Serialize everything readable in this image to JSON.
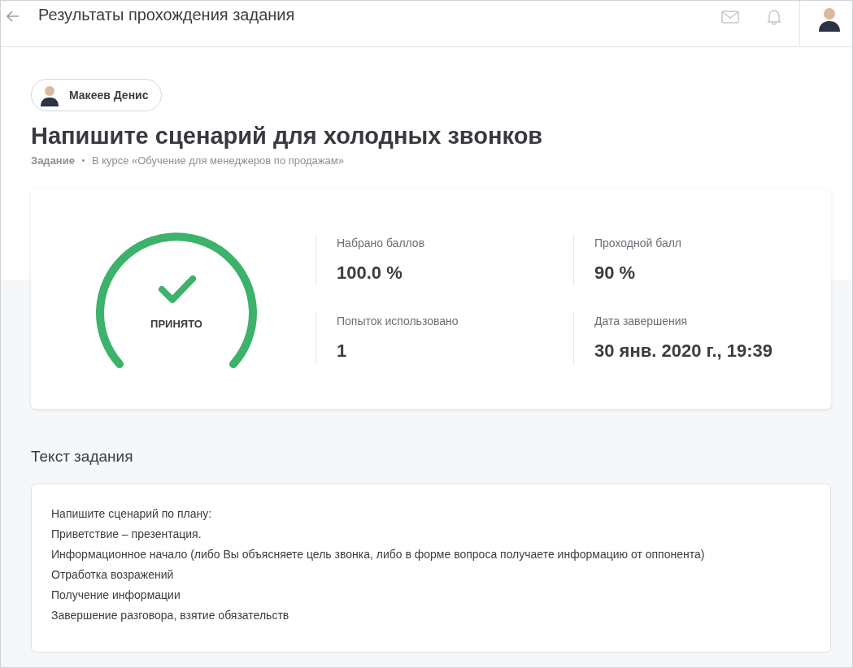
{
  "header": {
    "title": "Результаты прохождения задания"
  },
  "student": {
    "name": "Макеев Денис"
  },
  "task": {
    "title": "Напишите сценарий для холодных звонков",
    "type": "Задание",
    "course": "В курсе «Обучение для менеджеров по продажам»"
  },
  "result": {
    "accepted": true,
    "status_label": "ПРИНЯТО",
    "stats": [
      {
        "label": "Набрано баллов",
        "value": "100.0 %"
      },
      {
        "label": "Проходной балл",
        "value": "90 %"
      },
      {
        "label": "Попыток использовано",
        "value": "1"
      },
      {
        "label": "Дата завершения",
        "value": "30 янв. 2020 г., 19:39"
      }
    ]
  },
  "task_text": {
    "heading": "Текст задания",
    "lines": [
      "Напишите сценарий по плану:",
      "Приветствие – презентация.",
      "Информационное начало (либо Вы объясняете цель звонка, либо в форме вопроса получаете информацию от оппонента)",
      "Отработка возражений",
      "Получение информации",
      "Завершение разговора, взятие обязательств"
    ]
  }
}
